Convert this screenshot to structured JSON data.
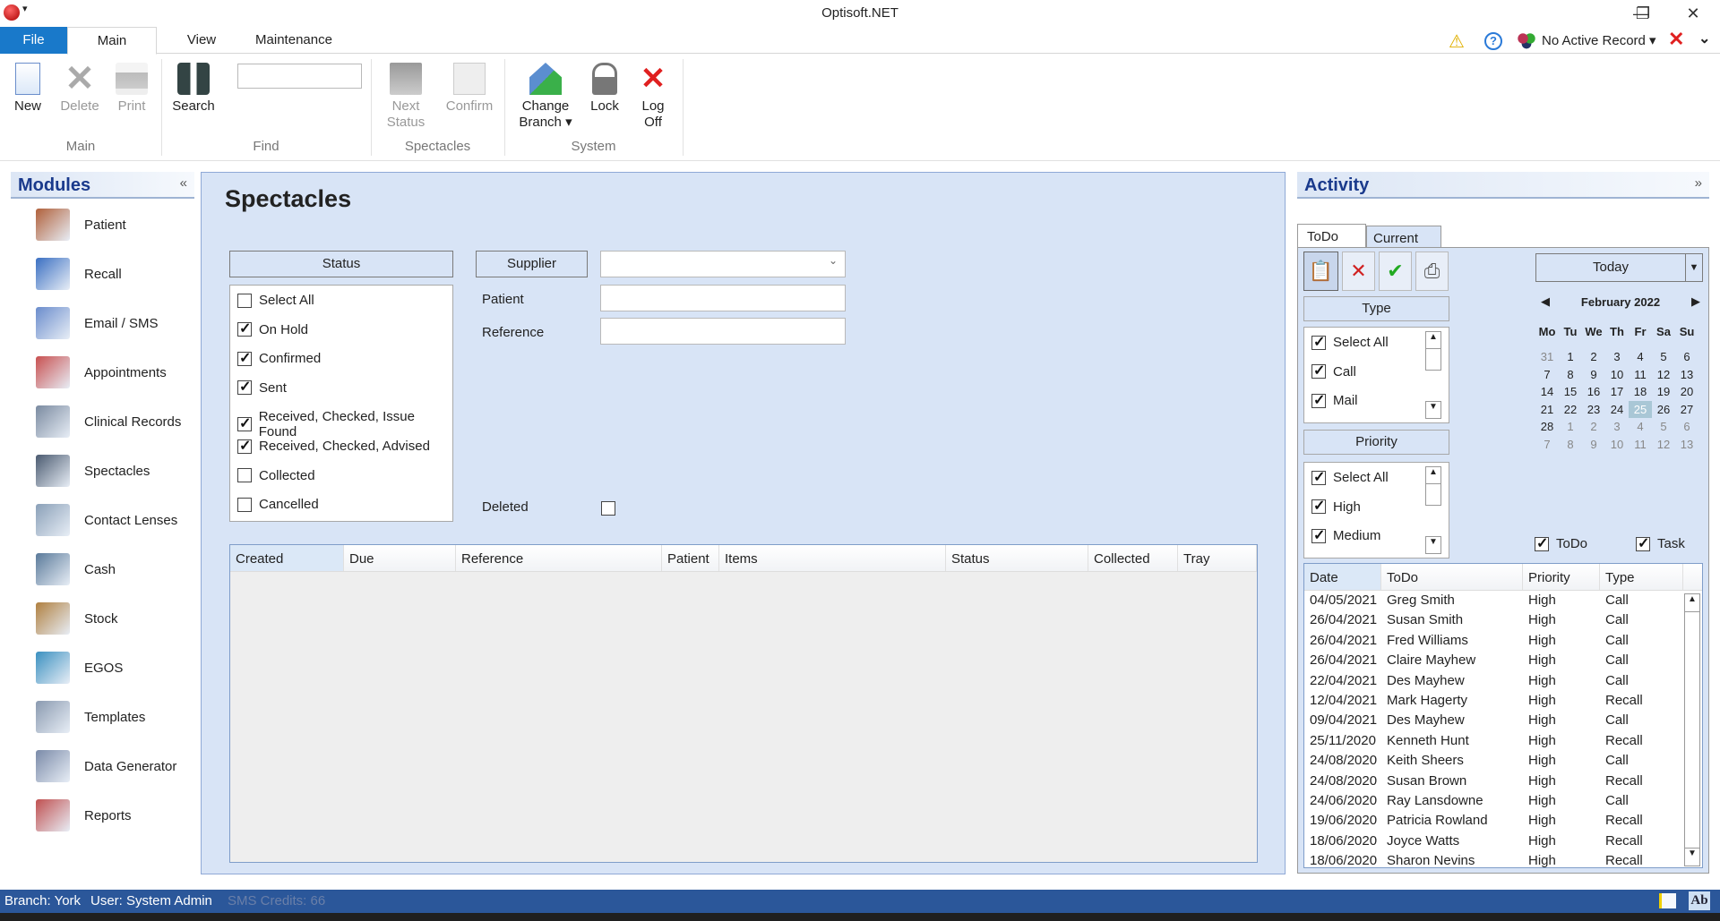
{
  "window": {
    "title": "Optisoft.NET",
    "minimize": "—",
    "restore": "❐",
    "close": "✕"
  },
  "ribbon": {
    "tabs": [
      {
        "label": "File"
      },
      {
        "label": "Main"
      },
      {
        "label": "View"
      },
      {
        "label": "Maintenance"
      }
    ],
    "active_tab": "Main",
    "right": {
      "active_record": "No Active Record ▾"
    },
    "groups": {
      "main": "Main",
      "find": "Find",
      "spectacles": "Spectacles",
      "system": "System"
    },
    "buttons": {
      "new": "New",
      "delete": "Delete",
      "print": "Print",
      "search": "Search",
      "next_status_1": "Next",
      "next_status_2": "Status",
      "confirm": "Confirm",
      "change_branch_1": "Change",
      "change_branch_2": "Branch ▾",
      "lock": "Lock",
      "log_off_1": "Log",
      "log_off_2": "Off"
    },
    "find_input": ""
  },
  "modules": {
    "title": "Modules",
    "collapse": "«",
    "items": [
      {
        "label": "Patient",
        "icon": "patient-icon",
        "color": "#b0603a"
      },
      {
        "label": "Recall",
        "icon": "recall-chart-icon",
        "color": "#3a6fc2"
      },
      {
        "label": "Email / SMS",
        "icon": "email-sms-icon",
        "color": "#6a8ccc"
      },
      {
        "label": "Appointments",
        "icon": "calendar-clock-icon",
        "color": "#c85050"
      },
      {
        "label": "Clinical Records",
        "icon": "clinical-records-icon",
        "color": "#7a8aa0"
      },
      {
        "label": "Spectacles",
        "icon": "spectacles-icon",
        "color": "#4a5a70"
      },
      {
        "label": "Contact Lenses",
        "icon": "contact-lenses-icon",
        "color": "#8aa0b8"
      },
      {
        "label": "Cash",
        "icon": "cash-register-icon",
        "color": "#5a7a9a"
      },
      {
        "label": "Stock",
        "icon": "stock-box-icon",
        "color": "#b08040"
      },
      {
        "label": "EGOS",
        "icon": "egos-icon",
        "color": "#3a90c0"
      },
      {
        "label": "Templates",
        "icon": "templates-icon",
        "color": "#8a9ab0"
      },
      {
        "label": "Data Generator",
        "icon": "data-generator-icon",
        "color": "#7a8aa8"
      },
      {
        "label": "Reports",
        "icon": "reports-icon",
        "color": "#c05050"
      }
    ]
  },
  "main": {
    "title": "Spectacles",
    "status_header": "Status",
    "status_items": [
      {
        "label": "Select All",
        "checked": false
      },
      {
        "label": "On Hold",
        "checked": true
      },
      {
        "label": "Confirmed",
        "checked": true
      },
      {
        "label": "Sent",
        "checked": true
      },
      {
        "label": "Received, Checked, Issue Found",
        "checked": true
      },
      {
        "label": "Received, Checked, Advised",
        "checked": true
      },
      {
        "label": "Collected",
        "checked": false
      },
      {
        "label": "Cancelled",
        "checked": false
      }
    ],
    "supplier_button": "Supplier",
    "supplier_value": "",
    "supplier_chevron": "⌄",
    "patient_label": "Patient",
    "patient_value": "",
    "reference_label": "Reference",
    "reference_value": "",
    "deleted_label": "Deleted",
    "deleted_checked": false,
    "grid_columns": [
      "Created",
      "Due",
      "Reference",
      "Patient",
      "Items",
      "Status",
      "Collected",
      "Tray"
    ]
  },
  "activity": {
    "title": "Activity",
    "expand": "»",
    "tabs": [
      "ToDo",
      "Current"
    ],
    "today": "Today",
    "dropdown": "▼",
    "type_header": "Type",
    "type_items": [
      {
        "label": "Select All",
        "checked": true
      },
      {
        "label": "Call",
        "checked": true
      },
      {
        "label": "Mail",
        "checked": true
      }
    ],
    "priority_header": "Priority",
    "priority_items": [
      {
        "label": "Select All",
        "checked": true
      },
      {
        "label": "High",
        "checked": true
      },
      {
        "label": "Medium",
        "checked": true
      }
    ],
    "calendar": {
      "month": "February 2022",
      "prev": "◀",
      "next": "▶",
      "dow": [
        "Mo",
        "Tu",
        "We",
        "Th",
        "Fr",
        "Sa",
        "Su"
      ],
      "weeks": [
        [
          "31",
          "1",
          "2",
          "3",
          "4",
          "5",
          "6"
        ],
        [
          "7",
          "8",
          "9",
          "10",
          "11",
          "12",
          "13"
        ],
        [
          "14",
          "15",
          "16",
          "17",
          "18",
          "19",
          "20"
        ],
        [
          "21",
          "22",
          "23",
          "24",
          "25",
          "26",
          "27"
        ],
        [
          "28",
          "1",
          "2",
          "3",
          "4",
          "5",
          "6"
        ],
        [
          "7",
          "8",
          "9",
          "10",
          "11",
          "12",
          "13"
        ]
      ],
      "selected": "25"
    },
    "show_todo": {
      "label": "ToDo",
      "checked": true
    },
    "show_task": {
      "label": "Task",
      "checked": true
    },
    "columns": [
      "Date",
      "ToDo",
      "Priority",
      "Type"
    ],
    "rows": [
      [
        "04/05/2021",
        "Greg Smith",
        "High",
        "Call"
      ],
      [
        "26/04/2021",
        "Susan Smith",
        "High",
        "Call"
      ],
      [
        "26/04/2021",
        "Fred Williams",
        "High",
        "Call"
      ],
      [
        "26/04/2021",
        "Claire Mayhew",
        "High",
        "Call"
      ],
      [
        "22/04/2021",
        "Des Mayhew",
        "High",
        "Call"
      ],
      [
        "12/04/2021",
        "Mark Hagerty",
        "High",
        "Recall"
      ],
      [
        "09/04/2021",
        "Des Mayhew",
        "High",
        "Call"
      ],
      [
        "25/11/2020",
        "Kenneth Hunt",
        "High",
        "Recall"
      ],
      [
        "24/08/2020",
        "Keith Sheers",
        "High",
        "Call"
      ],
      [
        "24/08/2020",
        "Susan Brown",
        "High",
        "Recall"
      ],
      [
        "24/06/2020",
        "Ray Lansdowne",
        "High",
        "Call"
      ],
      [
        "19/06/2020",
        "Patricia Rowland",
        "High",
        "Recall"
      ],
      [
        "18/06/2020",
        "Joyce Watts",
        "High",
        "Recall"
      ],
      [
        "18/06/2020",
        "Sharon Nevins",
        "High",
        "Recall"
      ]
    ]
  },
  "statusbar": {
    "branch": "Branch: York",
    "user": "User: System Admin",
    "sms": "SMS Credits: 66",
    "ab": "Ab"
  },
  "colors": {
    "file_tab": "#1979ca",
    "panel_bg": "#d8e4f6",
    "statusbar": "#2b579a",
    "accent_text": "#1a3a8c"
  }
}
